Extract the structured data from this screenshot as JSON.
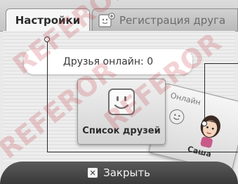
{
  "tabs": {
    "settings_label": "Настройки",
    "register_label": "Регистрация друга"
  },
  "status": {
    "online_text": "Друзья онлайн: 0"
  },
  "friend_list": {
    "label": "Список друзей"
  },
  "online_card": {
    "label": "Онлайн",
    "name": "Сашa"
  },
  "footer": {
    "close_label": "Закрыть",
    "close_glyph": "✕"
  },
  "watermark": {
    "text": "REFEROR"
  },
  "colors": {
    "close_bar": "#4a4a4a",
    "callout": "#2a2a2a"
  }
}
